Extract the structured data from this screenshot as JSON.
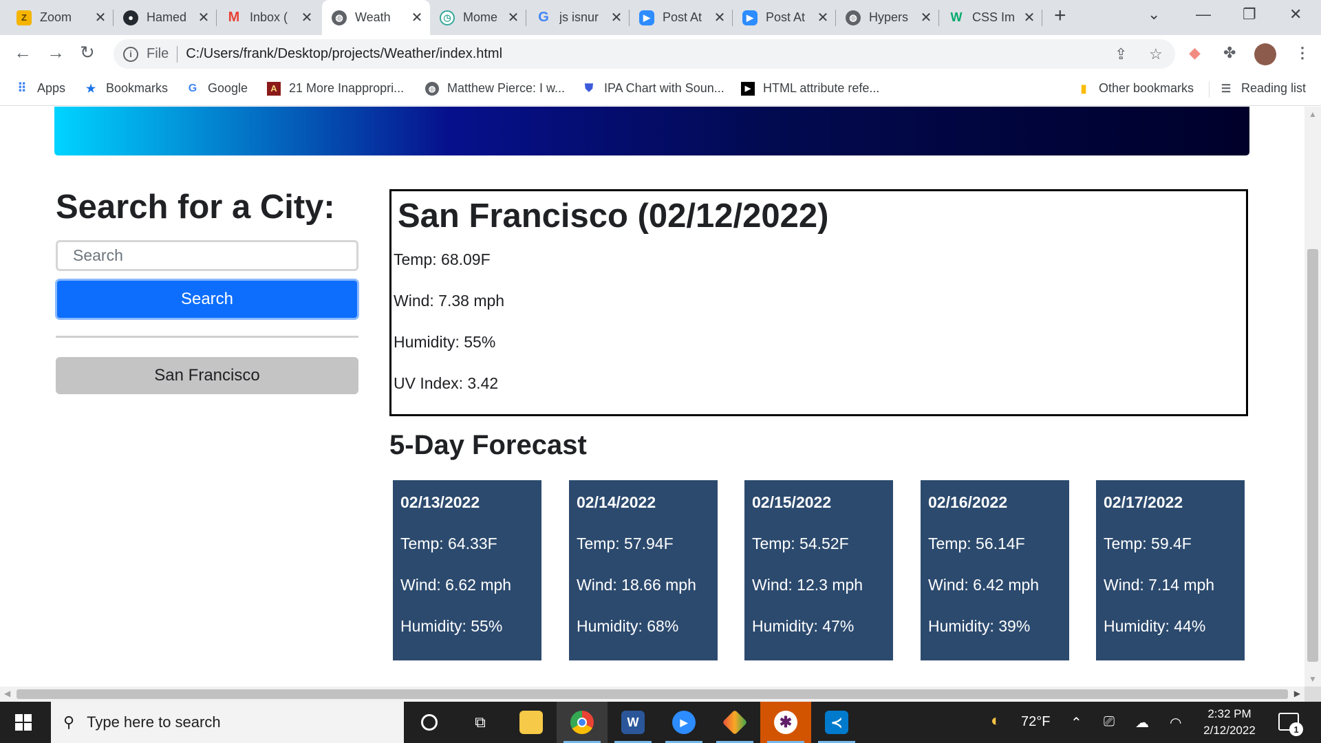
{
  "browser": {
    "tabs": [
      {
        "title": "Zoom",
        "icon": "zoom-eats-icon",
        "color": "#f4b400"
      },
      {
        "title": "Hamed",
        "icon": "github-icon",
        "color": "#24292f"
      },
      {
        "title": "Inbox (",
        "icon": "gmail-icon",
        "color": "#ea4335"
      },
      {
        "title": "Weath",
        "icon": "globe-icon",
        "color": "#5f6368",
        "active": true
      },
      {
        "title": "Mome",
        "icon": "clock-icon",
        "color": "#34a89a"
      },
      {
        "title": "js isnur",
        "icon": "google-icon",
        "color": "#4285f4"
      },
      {
        "title": "Post At",
        "icon": "zoom-icon",
        "color": "#2d8cff"
      },
      {
        "title": "Post At",
        "icon": "zoom-icon",
        "color": "#2d8cff"
      },
      {
        "title": "Hypers",
        "icon": "globe-icon",
        "color": "#5f6368"
      },
      {
        "title": "CSS Im",
        "icon": "w3schools-icon",
        "color": "#04aa6d"
      }
    ],
    "address": {
      "protocol_label": "File",
      "url": "C:/Users/frank/Desktop/projects/Weather/index.html"
    },
    "bookmarks": [
      {
        "label": "Apps",
        "icon": "apps-grid-icon"
      },
      {
        "label": "Bookmarks",
        "icon": "star-icon"
      },
      {
        "label": "Google",
        "icon": "google-icon"
      },
      {
        "label": "21 More Inappropri...",
        "icon": "bookmark-site-icon"
      },
      {
        "label": "Matthew Pierce: I w...",
        "icon": "globe-icon"
      },
      {
        "label": "IPA Chart with Soun...",
        "icon": "shield-icon"
      },
      {
        "label": "HTML attribute refe...",
        "icon": "video-icon"
      }
    ],
    "other_bookmarks": "Other bookmarks",
    "reading_list": "Reading list"
  },
  "search": {
    "title": "Search for a City:",
    "placeholder": "Search",
    "button": "Search",
    "history": [
      "San Francisco"
    ]
  },
  "current": {
    "heading": "San Francisco (02/12/2022)",
    "temp": "Temp: 68.09F",
    "wind": "Wind: 7.38 mph",
    "humidity": "Humidity: 55%",
    "uv": "UV Index: 3.42"
  },
  "forecast": {
    "title": "5-Day Forecast",
    "days": [
      {
        "date": "02/13/2022",
        "temp": "Temp: 64.33F",
        "wind": "Wind: 6.62 mph",
        "humidity": "Humidity: 55%"
      },
      {
        "date": "02/14/2022",
        "temp": "Temp: 57.94F",
        "wind": "Wind: 18.66 mph",
        "humidity": "Humidity: 68%"
      },
      {
        "date": "02/15/2022",
        "temp": "Temp: 54.52F",
        "wind": "Wind: 12.3 mph",
        "humidity": "Humidity: 47%"
      },
      {
        "date": "02/16/2022",
        "temp": "Temp: 56.14F",
        "wind": "Wind: 6.42 mph",
        "humidity": "Humidity: 39%"
      },
      {
        "date": "02/17/2022",
        "temp": "Temp: 59.4F",
        "wind": "Wind: 7.14 mph",
        "humidity": "Humidity: 44%"
      }
    ]
  },
  "taskbar": {
    "search_placeholder": "Type here to search",
    "weather": "72°F",
    "time": "2:32 PM",
    "date": "2/12/2022",
    "notifications": "1"
  },
  "colors": {
    "search_button": "#0d6efd",
    "forecast_card": "#2c4a6e",
    "history_button": "#c4c4c4"
  }
}
